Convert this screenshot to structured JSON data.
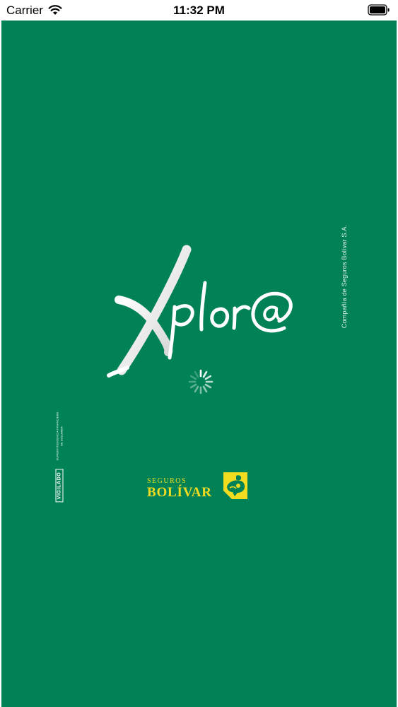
{
  "status_bar": {
    "carrier": "Carrier",
    "time": "11:32 PM"
  },
  "splash": {
    "background_color": "#018256",
    "logo_text": "Xplor@",
    "loading": true,
    "company_text": "Compañía de Seguros Bolívar S.A.",
    "vigilado_label": "VIGILADO",
    "vigilado_text": "SUPERINTENDENCIA FINANCIERA",
    "vigilado_country": "DE COLOMBIA",
    "brand_top": "SEGUROS",
    "brand_main": "BOLÍVAR",
    "brand_color": "#f2dc1f",
    "brand_emblem_icon": "bolivar-horse-rider-icon"
  }
}
